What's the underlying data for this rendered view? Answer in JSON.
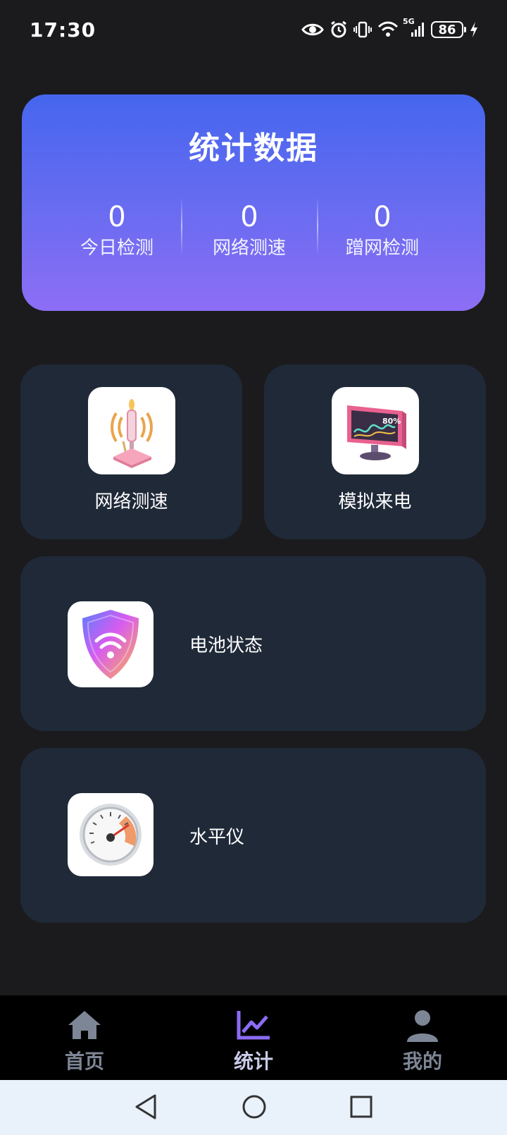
{
  "status_bar": {
    "time": "17:30",
    "network": "5G",
    "battery": "86",
    "icons": [
      "eye-icon",
      "alarm-icon",
      "vibrate-icon",
      "wifi-icon",
      "signal-icon",
      "battery-icon",
      "charging-icon"
    ]
  },
  "stats": {
    "title": "统计数据",
    "items": [
      {
        "value": "0",
        "label": "今日检测"
      },
      {
        "value": "0",
        "label": "网络测速"
      },
      {
        "value": "0",
        "label": "蹭网检测"
      }
    ]
  },
  "features": {
    "network_speed": {
      "label": "网络测速",
      "icon": "antenna-icon"
    },
    "simulate_call": {
      "label": "模拟来电",
      "icon": "monitor-icon",
      "icon_text": "80%"
    },
    "battery_status": {
      "label": "电池状态",
      "icon": "shield-wifi-icon"
    },
    "level": {
      "label": "水平仪",
      "icon": "speedometer-icon"
    }
  },
  "bottom_nav": {
    "items": [
      {
        "label": "首页",
        "icon": "home-icon",
        "active": false
      },
      {
        "label": "统计",
        "icon": "chart-icon",
        "active": true
      },
      {
        "label": "我的",
        "icon": "user-icon",
        "active": false
      }
    ]
  },
  "system_nav": {
    "icons": [
      "back-icon",
      "home-circle-icon",
      "recents-icon"
    ]
  },
  "colors": {
    "background": "#1b1b1d",
    "card": "#1f2938",
    "gradient_top": "#4566ee",
    "gradient_bottom": "#8d6ef5",
    "nav_active": "#8b6cf4",
    "nav_inactive": "#7d8696"
  }
}
